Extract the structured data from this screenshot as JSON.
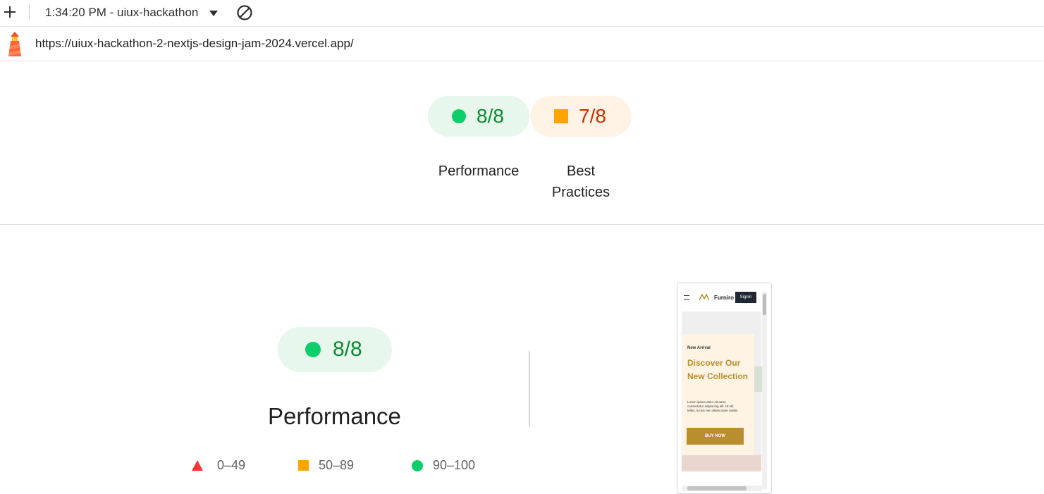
{
  "toolbar": {
    "report_title": "1:34:20 PM - uiux-hackathon",
    "add_icon": "plus-icon",
    "clear_icon": "block-icon"
  },
  "urlbar": {
    "url": "https://uiux-hackathon-2-nextjs-design-jam-2024.vercel.app/",
    "logo_icon": "lighthouse-icon"
  },
  "gauges": [
    {
      "label_line1": "Performance",
      "label_line2": "",
      "score": "8/8",
      "status": "pass",
      "color": "#0cce6b"
    },
    {
      "label_line1": "Best",
      "label_line2": "Practices",
      "score": "7/8",
      "status": "average",
      "color": "#ffa400"
    }
  ],
  "performance": {
    "score": "8/8",
    "title": "Performance",
    "legend": [
      {
        "range": "0–49",
        "color": "#ff3333",
        "shape": "triangle"
      },
      {
        "range": "50–89",
        "color": "#ffa400",
        "shape": "square"
      },
      {
        "range": "90–100",
        "color": "#0cce6b",
        "shape": "circle"
      }
    ]
  },
  "thumbnail": {
    "brand": "Furniro",
    "signin": "Signin",
    "new_arrival": "New Arrival",
    "headline": "Discover Our New Collection",
    "body": "Lorem ipsum dolor sit amet, consectetur adipiscing elit. Ut elit tellus, luctus nec ullamcorper mattis.",
    "button": "BUY NOW",
    "accent": "#b88e2f"
  }
}
